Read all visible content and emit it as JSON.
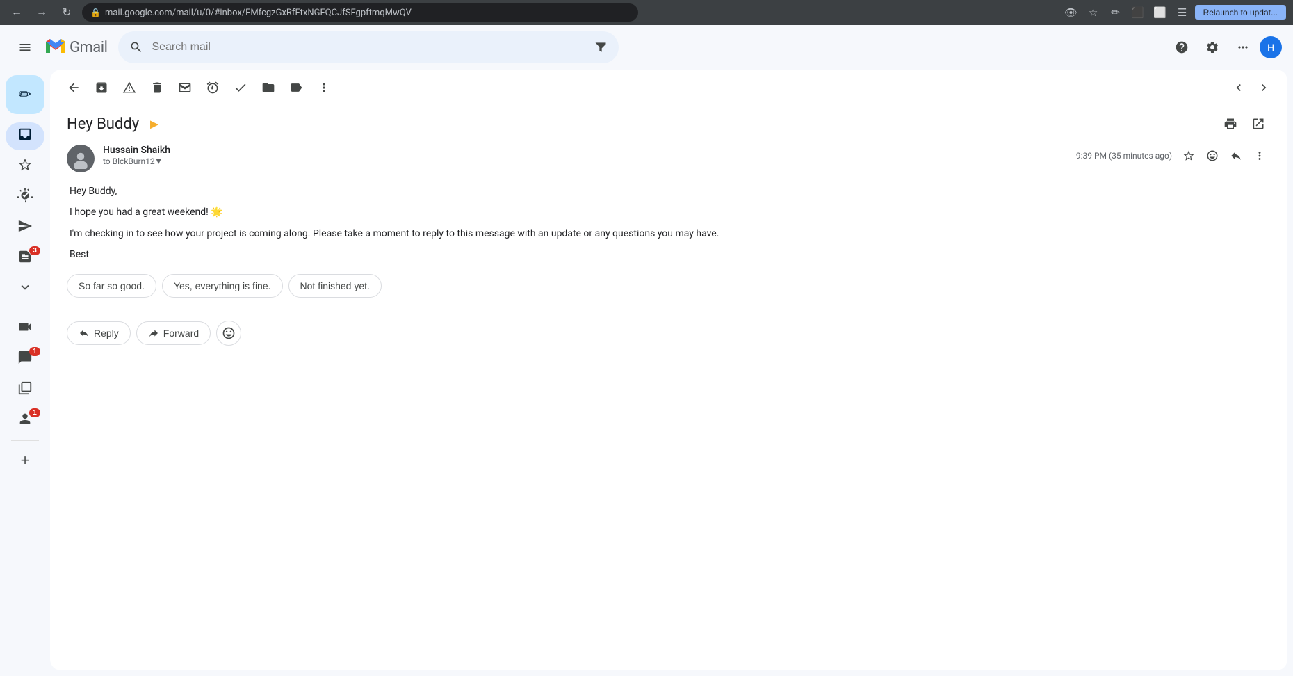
{
  "browser": {
    "url": "mail.google.com/mail/u/0/#inbox/FMfcgzGxRfFtxNGFQCJfSFgpftmqMwQV",
    "relaunch_label": "Relaunch to updat..."
  },
  "gmail": {
    "logo_text": "Gmail",
    "search_placeholder": "Search mail",
    "avatar_letter": "H"
  },
  "toolbar": {
    "back_label": "←",
    "archive_label": "⬜",
    "spam_label": "⚑",
    "delete_label": "🗑",
    "mark_label": "✉",
    "snooze_label": "⏰",
    "done_label": "✓",
    "move_label": "📁",
    "labels_label": "🏷",
    "more_label": "⋮",
    "prev_label": "‹",
    "next_label": "›"
  },
  "email": {
    "subject": "Hey Buddy",
    "important_icon": "►",
    "sender_name": "Hussain Shaikh",
    "sender_to_text": "to BlckBurn12",
    "timestamp": "9:39 PM (35 minutes ago)",
    "body_lines": [
      "Hey Buddy,",
      "I hope you had a great weekend! 🌟",
      "I'm checking in to see how your project is coming along. Please take a moment to reply to this message with an update or any questions you may have.",
      "Best"
    ],
    "smart_replies": [
      "So far so good.",
      "Yes, everything is fine.",
      "Not finished yet."
    ],
    "reply_label": "Reply",
    "forward_label": "Forward"
  },
  "sidebar": {
    "compose_icon": "✏",
    "items": [
      {
        "name": "inbox",
        "icon": "📥",
        "active": true
      },
      {
        "name": "starred",
        "icon": "☆",
        "active": false
      },
      {
        "name": "snoozed",
        "icon": "⏰",
        "active": false
      },
      {
        "name": "sent",
        "icon": "➤",
        "active": false
      },
      {
        "name": "drafts",
        "icon": "📄",
        "badge": "3",
        "active": false
      },
      {
        "name": "more",
        "icon": "›",
        "active": false
      },
      {
        "name": "meet",
        "icon": "📹",
        "active": false
      },
      {
        "name": "chat",
        "icon": "💬",
        "badge": "1",
        "active": false
      },
      {
        "name": "spaces",
        "icon": "◻",
        "active": false
      },
      {
        "name": "contacts",
        "icon": "👤",
        "badge": "1",
        "active": false
      }
    ]
  }
}
